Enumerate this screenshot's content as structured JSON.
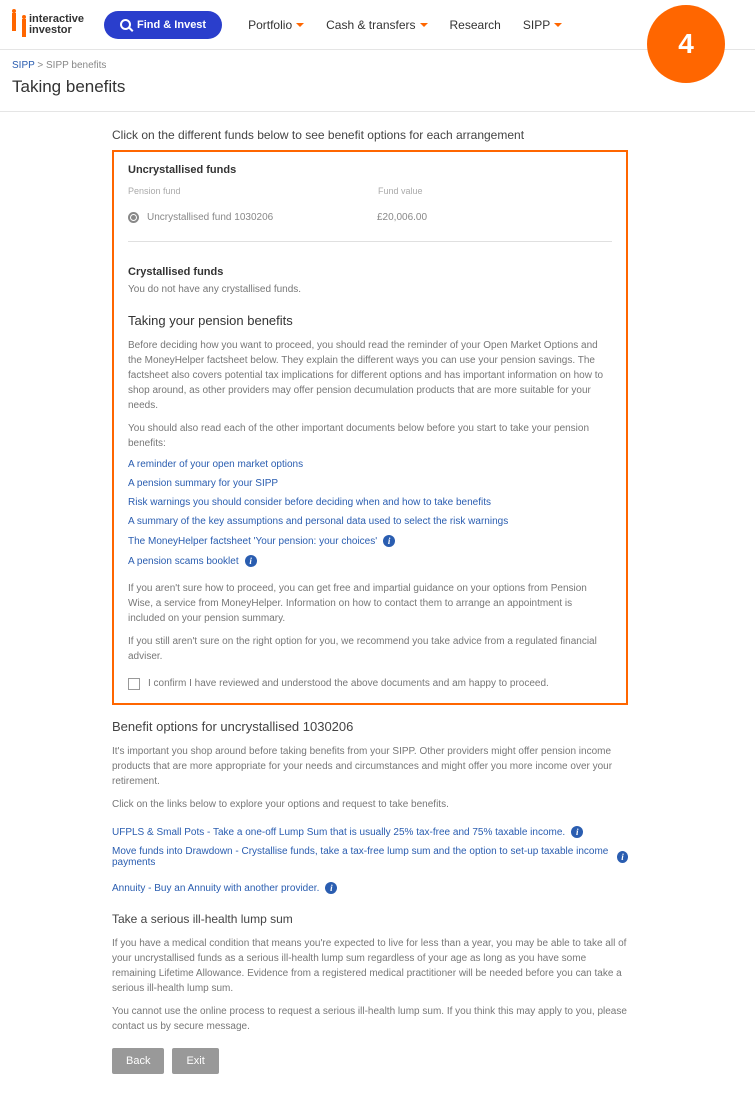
{
  "logo": {
    "l1": "interactive",
    "l2": "investor"
  },
  "findInvest": "Find & Invest",
  "nav": {
    "portfolio": "Portfolio",
    "cash": "Cash & transfers",
    "research": "Research",
    "sipp": "SIPP"
  },
  "badge": "4",
  "crumbs": {
    "sipp": "SIPP",
    "sep": " > ",
    "current": "SIPP benefits"
  },
  "h1": "Taking benefits",
  "intro": "Click on the different funds below to see benefit options for each arrangement",
  "uncryst": {
    "hd": "Uncrystallised funds",
    "col1": "Pension fund",
    "col2": "Fund value",
    "fund": "Uncrystallised fund 1030206",
    "val": "£20,006.00"
  },
  "cryst": {
    "hd": "Crystallised funds",
    "txt": "You do not have any crystallised funds."
  },
  "tpb": {
    "hd": "Taking your pension benefits",
    "p1": "Before deciding how you want to proceed, you should read the reminder of your Open Market Options and the MoneyHelper factsheet below. They explain the different ways you can use your pension savings. The factsheet also covers potential tax implications for different options and has important information on how to shop around, as other providers may offer pension decumulation products that are more suitable for your needs.",
    "p2": "You should also read each of the other important documents below before you start to take your pension benefits:",
    "l1": "A reminder of your open market options",
    "l2": "A pension summary for your SIPP",
    "l3": "Risk warnings you should consider before deciding when and how to take benefits",
    "l4": "A summary of the key assumptions and personal data used to select the risk warnings",
    "l5": "The MoneyHelper factsheet 'Your pension: your choices'",
    "l6": "A pension scams booklet",
    "p3": "If you aren't sure how to proceed, you can get free and impartial guidance on your options from Pension Wise, a service from MoneyHelper. Information on how to contact them to arrange an appointment is included on your pension summary.",
    "p4": "If you still aren't sure on the right option for you, we recommend you take advice from a regulated financial adviser.",
    "confirm": "I confirm I have reviewed and understood the above documents and am happy to proceed."
  },
  "bo": {
    "hd": "Benefit options for uncrystallised 1030206",
    "p1": "It's important you shop around before taking benefits from your SIPP. Other providers might offer pension income products that are more appropriate for your needs and circumstances and might offer you more income over your retirement.",
    "p2": "Click on the links below to explore your options and request to take benefits.",
    "l1": "UFPLS & Small Pots - Take a one-off Lump Sum that is usually 25% tax-free and 75% taxable income.",
    "l2": "Move funds into Drawdown - Crystallise funds, take a tax-free lump sum and the option to set-up taxable income payments",
    "l3": "Annuity - Buy an Annuity with another provider."
  },
  "ill": {
    "hd": "Take a serious ill-health lump sum",
    "p1": "If you have a medical condition that means you're expected to live for less than a year, you may be able to take all of your uncrystallised funds as a serious ill-health lump sum regardless of your age as long as you have some remaining Lifetime Allowance. Evidence from a registered medical practitioner will be needed before you can take a serious ill-health lump sum.",
    "p2": "You cannot use the online process to request a serious ill-health lump sum. If you think this may apply to you, please contact us by secure message."
  },
  "btns": {
    "back": "Back",
    "exit": "Exit"
  }
}
